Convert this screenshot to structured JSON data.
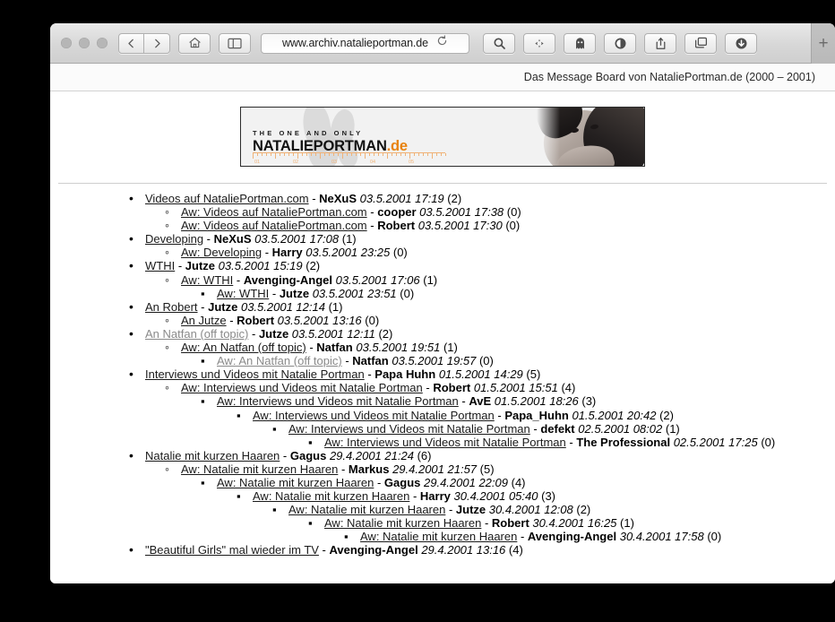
{
  "browser": {
    "url": "www.archiv.natalieportman.de",
    "new_tab_label": "+",
    "icons": {
      "back": "back-chevron-icon",
      "forward": "forward-chevron-icon",
      "home": "home-icon",
      "sidebar": "sidebar-icon",
      "reload": "reload-icon",
      "search": "search-icon",
      "sparkle": "sparkle-icon",
      "ghost": "ghost-icon",
      "shield": "shield-icon",
      "share": "share-icon",
      "tabs": "tabs-icon",
      "downloads": "downloads-icon"
    }
  },
  "page": {
    "header_title": "Das Message Board von NataliePortman.de (2000 – 2001)",
    "banner": {
      "tagline": "THE ONE AND ONLY",
      "name": "NATALIEPORTMAN",
      "suffix": ".de",
      "ruler_numbers": [
        "01",
        "02",
        "03",
        "04",
        "05"
      ],
      "accent_color": "#e8820c"
    },
    "threads": [
      {
        "level": 0,
        "bullet": "disc",
        "title": "Videos auf NataliePortman.com",
        "visited": false,
        "author": "NeXuS",
        "timestamp": "03.5.2001 17:19",
        "replies": "(2)"
      },
      {
        "level": 1,
        "bullet": "circle",
        "title": "Aw: Videos auf NataliePortman.com",
        "visited": false,
        "author": "cooper",
        "timestamp": "03.5.2001 17:38",
        "replies": "(0)"
      },
      {
        "level": 1,
        "bullet": "circle",
        "title": "Aw: Videos auf NataliePortman.com",
        "visited": false,
        "author": "Robert",
        "timestamp": "03.5.2001 17:30",
        "replies": "(0)"
      },
      {
        "level": 0,
        "bullet": "disc",
        "title": "Developing",
        "visited": false,
        "author": "NeXuS",
        "timestamp": "03.5.2001 17:08",
        "replies": "(1)"
      },
      {
        "level": 1,
        "bullet": "circle",
        "title": "Aw: Developing",
        "visited": false,
        "author": "Harry",
        "timestamp": "03.5.2001 23:25",
        "replies": "(0)"
      },
      {
        "level": 0,
        "bullet": "disc",
        "title": "WTHI",
        "visited": false,
        "author": "Jutze",
        "timestamp": "03.5.2001 15:19",
        "replies": "(2)"
      },
      {
        "level": 1,
        "bullet": "circle",
        "title": "Aw: WTHI",
        "visited": false,
        "author": "Avenging-Angel",
        "timestamp": "03.5.2001 17:06",
        "replies": "(1)"
      },
      {
        "level": 2,
        "bullet": "square",
        "title": "Aw: WTHI",
        "visited": false,
        "author": "Jutze",
        "timestamp": "03.5.2001 23:51",
        "replies": "(0)"
      },
      {
        "level": 0,
        "bullet": "disc",
        "title": "An Robert",
        "visited": false,
        "author": "Jutze",
        "timestamp": "03.5.2001 12:14",
        "replies": "(1)"
      },
      {
        "level": 1,
        "bullet": "circle",
        "title": "An Jutze",
        "visited": false,
        "author": "Robert",
        "timestamp": "03.5.2001 13:16",
        "replies": "(0)"
      },
      {
        "level": 0,
        "bullet": "disc",
        "title": "An Natfan (off topic)",
        "visited": true,
        "author": "Jutze",
        "timestamp": "03.5.2001 12:11",
        "replies": "(2)"
      },
      {
        "level": 1,
        "bullet": "circle",
        "title": "Aw: An Natfan (off topic)",
        "visited": false,
        "author": "Natfan",
        "timestamp": "03.5.2001 19:51",
        "replies": "(1)"
      },
      {
        "level": 2,
        "bullet": "square",
        "title": "Aw: An Natfan (off topic)",
        "visited": true,
        "author": "Natfan",
        "timestamp": "03.5.2001 19:57",
        "replies": "(0)"
      },
      {
        "level": 0,
        "bullet": "disc",
        "title": "Interviews und Videos mit Natalie Portman",
        "visited": false,
        "author": "Papa Huhn",
        "timestamp": "01.5.2001 14:29",
        "replies": "(5)"
      },
      {
        "level": 1,
        "bullet": "circle",
        "title": "Aw: Interviews und Videos mit Natalie Portman",
        "visited": false,
        "author": "Robert",
        "timestamp": "01.5.2001 15:51",
        "replies": "(4)"
      },
      {
        "level": 2,
        "bullet": "square",
        "title": "Aw: Interviews und Videos mit Natalie Portman",
        "visited": false,
        "author": "AvE",
        "timestamp": "01.5.2001 18:26",
        "replies": "(3)"
      },
      {
        "level": 3,
        "bullet": "square",
        "title": "Aw: Interviews und Videos mit Natalie Portman",
        "visited": false,
        "author": "Papa_Huhn",
        "timestamp": "01.5.2001 20:42",
        "replies": "(2)"
      },
      {
        "level": 4,
        "bullet": "square",
        "title": "Aw: Interviews und Videos mit Natalie Portman",
        "visited": false,
        "author": "defekt",
        "timestamp": "02.5.2001 08:02",
        "replies": "(1)"
      },
      {
        "level": 5,
        "bullet": "square",
        "title": "Aw: Interviews und Videos mit Natalie Portman",
        "visited": false,
        "author": "The Professional",
        "timestamp": "02.5.2001 17:25",
        "replies": "(0)"
      },
      {
        "level": 0,
        "bullet": "disc",
        "title": "Natalie mit kurzen Haaren",
        "visited": false,
        "author": "Gagus",
        "timestamp": "29.4.2001 21:24",
        "replies": "(6)"
      },
      {
        "level": 1,
        "bullet": "circle",
        "title": "Aw: Natalie mit kurzen Haaren",
        "visited": false,
        "author": "Markus",
        "timestamp": "29.4.2001 21:57",
        "replies": "(5)"
      },
      {
        "level": 2,
        "bullet": "square",
        "title": "Aw: Natalie mit kurzen Haaren",
        "visited": false,
        "author": "Gagus",
        "timestamp": "29.4.2001 22:09",
        "replies": "(4)"
      },
      {
        "level": 3,
        "bullet": "square",
        "title": "Aw: Natalie mit kurzen Haaren",
        "visited": false,
        "author": "Harry",
        "timestamp": "30.4.2001 05:40",
        "replies": "(3)"
      },
      {
        "level": 4,
        "bullet": "square",
        "title": "Aw: Natalie mit kurzen Haaren",
        "visited": false,
        "author": "Jutze",
        "timestamp": "30.4.2001 12:08",
        "replies": "(2)"
      },
      {
        "level": 5,
        "bullet": "square",
        "title": "Aw: Natalie mit kurzen Haaren",
        "visited": false,
        "author": "Robert",
        "timestamp": "30.4.2001 16:25",
        "replies": "(1)"
      },
      {
        "level": 6,
        "bullet": "square",
        "title": "Aw: Natalie mit kurzen Haaren",
        "visited": false,
        "author": "Avenging-Angel",
        "timestamp": "30.4.2001 17:58",
        "replies": "(0)"
      },
      {
        "level": 0,
        "bullet": "disc",
        "title": "\"Beautiful Girls\" mal wieder im TV",
        "visited": false,
        "author": "Avenging-Angel",
        "timestamp": "29.4.2001 13:16",
        "replies": "(4)"
      }
    ]
  }
}
